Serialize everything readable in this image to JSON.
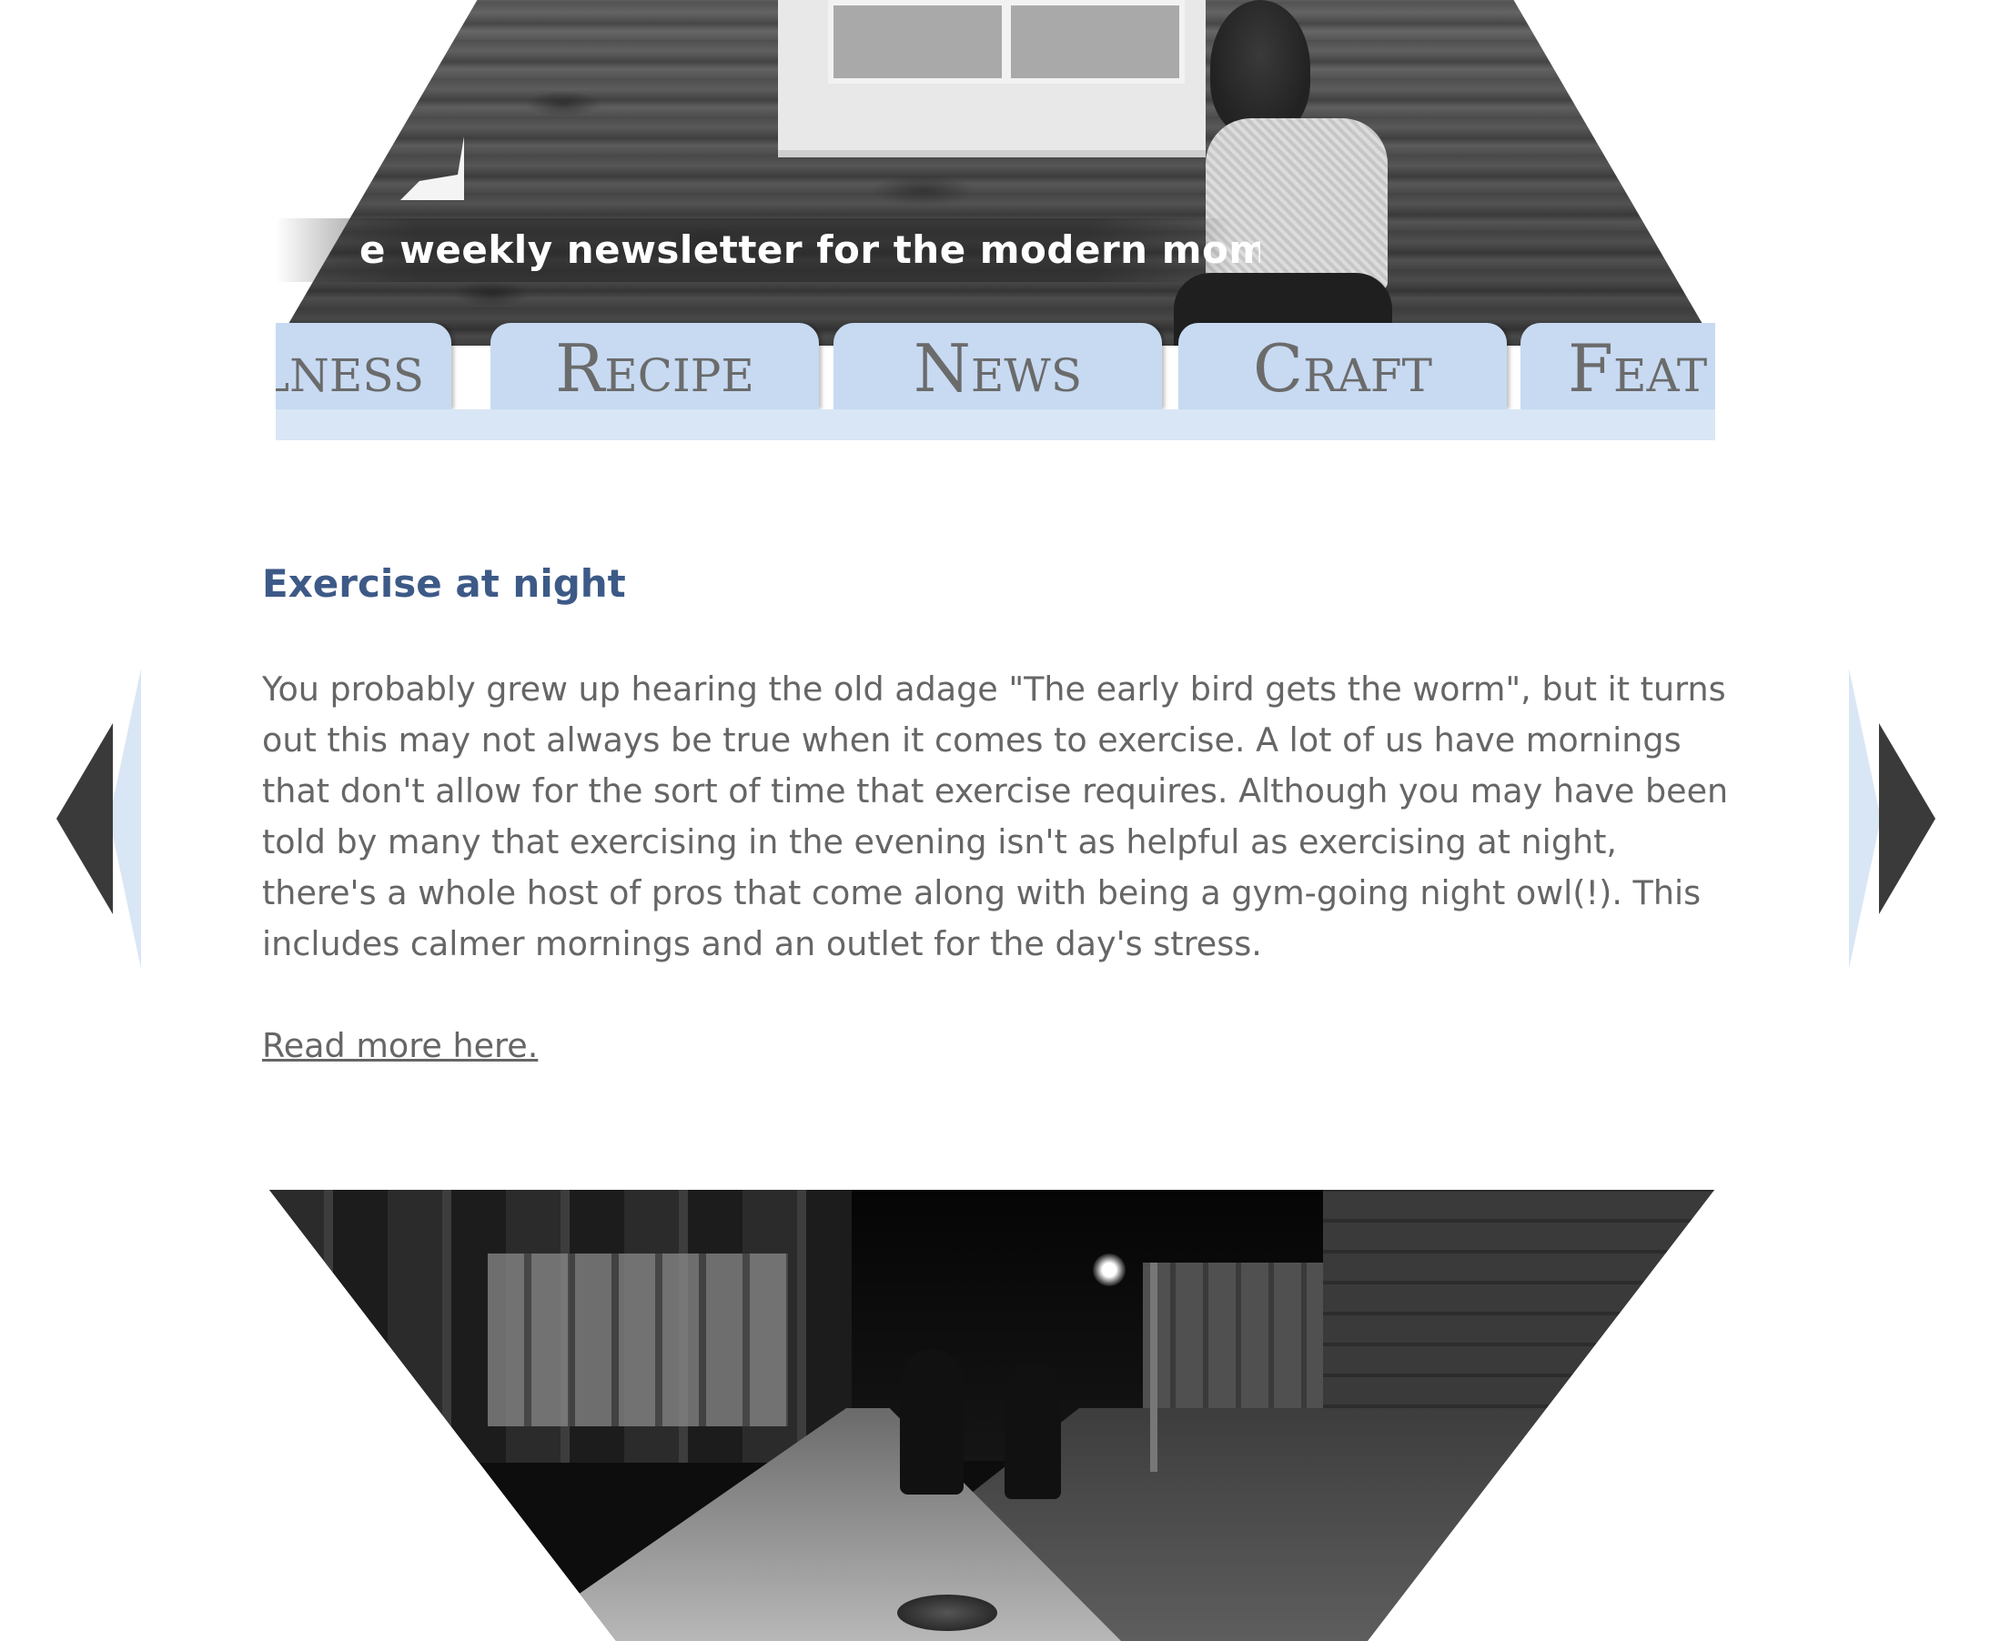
{
  "header": {
    "tagline": "e weekly newsletter for the modern mom"
  },
  "nav": {
    "tabs": [
      {
        "id": "wellness",
        "label": "Wellness"
      },
      {
        "id": "recipe",
        "label": "Recipe"
      },
      {
        "id": "news",
        "label": "News"
      },
      {
        "id": "craft",
        "label": "Craft"
      },
      {
        "id": "feature",
        "label": "Feat"
      }
    ],
    "tab_color": "#c7daf2",
    "base_color": "#d9e6f5"
  },
  "article": {
    "title": "Exercise at night",
    "body": "You probably grew up hearing the old adage \"The early bird gets the worm\", but it turns out this may not always be true when it comes to exercise. A lot of us have mornings that don't allow for the sort of time that exercise requires. Although you may have been told by many that exercising in the evening isn't as helpful as exercising at night, there's a whole host of pros that come along with being a gym-going night owl(!). This includes calmer mornings and an outlet for the day's stress.",
    "read_more": "Read more here.",
    "title_color": "#3d5a87",
    "text_color": "#666666"
  },
  "carousel": {
    "prev_icon": "arrow-left-icon",
    "next_icon": "arrow-right-icon",
    "arrow_color": "#3a3a3a"
  },
  "images": {
    "header_photo": "stone-wall-woman-photo",
    "article_photo": "night-street-walkers-photo"
  }
}
